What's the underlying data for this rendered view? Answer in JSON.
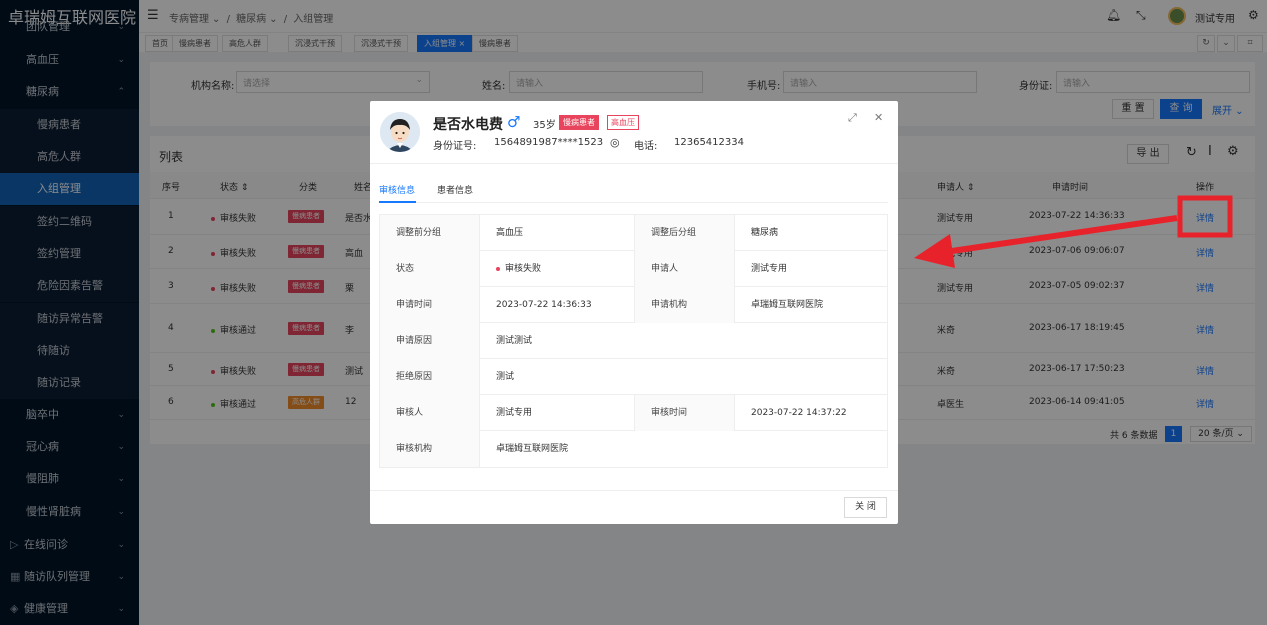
{
  "brand": "卓瑞姆互联网医院",
  "sidebar": {
    "items": [
      {
        "label": "团队管理",
        "chev": "⌄"
      },
      {
        "label": "高血压",
        "chev": "⌄"
      },
      {
        "label": "糖尿病",
        "chev": "⌃"
      },
      {
        "label": "慢病患者"
      },
      {
        "label": "高危人群"
      },
      {
        "label": "入组管理"
      },
      {
        "label": "签约二维码"
      },
      {
        "label": "签约管理"
      },
      {
        "label": "危险因素告警"
      },
      {
        "label": "随访异常告警"
      },
      {
        "label": "待随访"
      },
      {
        "label": "随访记录"
      },
      {
        "label": "脑卒中",
        "chev": "⌄"
      },
      {
        "label": "冠心病",
        "chev": "⌄"
      },
      {
        "label": "慢阻肺",
        "chev": "⌄"
      },
      {
        "label": "慢性肾脏病",
        "chev": "⌄"
      },
      {
        "label": "在线问诊",
        "chev": "⌄",
        "icon": "▷"
      },
      {
        "label": "随访队列管理",
        "chev": "⌄",
        "icon": "▦"
      },
      {
        "label": "健康管理",
        "chev": "⌄",
        "icon": "◈"
      }
    ]
  },
  "topbar": {
    "breadcrumb": [
      "专病管理",
      "糖尿病",
      "入组管理"
    ],
    "crumb_sep": "/",
    "crumb_chev": "⌄",
    "user": "测试专用",
    "icons": {
      "bell": "🔔︎",
      "fullscreen": "⤡",
      "settings": "⚙"
    }
  },
  "tabs": {
    "items": [
      "首页",
      "慢病患者",
      "高危人群",
      "沉浸式干预",
      "沉浸式干预",
      "入组管理 ×",
      "慢病患者"
    ],
    "refresh": "↻",
    "more": "⌄",
    "fit": "⌗"
  },
  "search": {
    "org_label": "机构名称:",
    "org_placeholder": "请选择",
    "name_label": "姓名:",
    "name_placeholder": "请输入",
    "phone_label": "手机号:",
    "phone_placeholder": "请输入",
    "id_label": "身份证:",
    "id_placeholder": "请输入",
    "reset": "重 置",
    "query": "查 询",
    "expand": "展开 ⌄"
  },
  "list": {
    "title": "列表",
    "export": "导 出",
    "headers": [
      "序号",
      "状态 ⇕",
      "分类",
      "姓名",
      "申请人 ⇕",
      "申请时间",
      "操作"
    ],
    "rows": [
      {
        "no": "1",
        "status": "审核失败",
        "status_color": "#e8445d",
        "category": "慢病患者",
        "cat_color": "#e8445d",
        "name": "是否水",
        "applicant": "测试专用",
        "time": "2023-07-22 14:36:33",
        "action": "详情"
      },
      {
        "no": "2",
        "status": "审核失败",
        "status_color": "#e8445d",
        "category": "慢病患者",
        "cat_color": "#e8445d",
        "name": "高血",
        "applicant": "测试专用",
        "time": "2023-07-06 09:06:07",
        "action": "详情"
      },
      {
        "no": "3",
        "status": "审核失败",
        "status_color": "#e8445d",
        "category": "慢病患者",
        "cat_color": "#e8445d",
        "name": "栗",
        "applicant": "测试专用",
        "time": "2023-07-05 09:02:37",
        "action": "详情"
      },
      {
        "no": "4",
        "status": "审核通过",
        "status_color": "#52c41a",
        "category": "慢病患者",
        "cat_color": "#e8445d",
        "name": "李",
        "applicant": "米奇",
        "time": "2023-06-17 18:19:45",
        "action": "详情"
      },
      {
        "no": "5",
        "status": "审核失败",
        "status_color": "#e8445d",
        "category": "慢病患者",
        "cat_color": "#e8445d",
        "name": "测试",
        "applicant": "米奇",
        "time": "2023-06-17 17:50:23",
        "action": "详情"
      },
      {
        "no": "6",
        "status": "审核通过",
        "status_color": "#52c41a",
        "category": "高危人群",
        "cat_color": "#f08c2a",
        "name": "12",
        "applicant": "卓医生",
        "time": "2023-06-14 09:41:05",
        "action": "详情"
      }
    ],
    "total": "共 6 条数据",
    "page": "1",
    "page_size": "20 条/页 ⌄"
  },
  "modal": {
    "name": "是否水电费",
    "sex": "♂",
    "age": "35岁",
    "tag1": "慢病患者",
    "tag2": "高血压",
    "id_label": "身份证号:",
    "id_value": "1564891987****1523",
    "phone_label": "电话:",
    "phone_value": "12365412334",
    "tab_review": "审核信息",
    "tab_patient": "患者信息",
    "details": {
      "before_group_label": "调整前分组",
      "before_group": "高血压",
      "after_group_label": "调整后分组",
      "after_group": "糖尿病",
      "status_label": "状态",
      "status": "审核失败",
      "applicant_label": "申请人",
      "applicant": "测试专用",
      "apply_time_label": "申请时间",
      "apply_time": "2023-07-22 14:36:33",
      "apply_org_label": "申请机构",
      "apply_org": "卓瑞姆互联网医院",
      "reason_label": "申请原因",
      "reason": "测试测试",
      "reject_label": "拒绝原因",
      "reject": "测试",
      "reviewer_label": "审核人",
      "reviewer": "测试专用",
      "review_time_label": "审核时间",
      "review_time": "2023-07-22 14:37:22",
      "review_org_label": "审核机构",
      "review_org": "卓瑞姆互联网医院"
    },
    "close": "关 闭",
    "ctrl_expand": "⤢",
    "ctrl_close": "✕",
    "eye": "◎"
  },
  "colors": {
    "accent": "#1677ff",
    "sidebar": "#001529",
    "danger": "#e8445d",
    "success": "#52c41a",
    "annotation": "#e8222a"
  }
}
